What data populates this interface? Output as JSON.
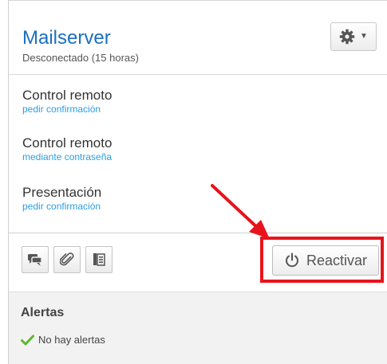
{
  "header": {
    "title": "Mailserver",
    "status": "Desconectado (15 horas)"
  },
  "items": [
    {
      "title": "Control remoto",
      "subtitle": "pedir confirmación"
    },
    {
      "title": "Control remoto",
      "subtitle": "mediante contraseña"
    },
    {
      "title": "Presentación",
      "subtitle": "pedir confirmación"
    }
  ],
  "actions": {
    "chat_icon": "chat-icon",
    "attach_icon": "paperclip-icon",
    "details_icon": "details-list-icon",
    "reactivate_label": "Reactivar",
    "reactivate_icon": "power-icon"
  },
  "alerts": {
    "title": "Alertas",
    "status": "No hay alertas",
    "status_icon": "checkmark-icon"
  },
  "colors": {
    "title": "#1a6fc1",
    "link": "#2b9ee3",
    "highlight": "#e8131b",
    "check": "#5cb82c"
  }
}
